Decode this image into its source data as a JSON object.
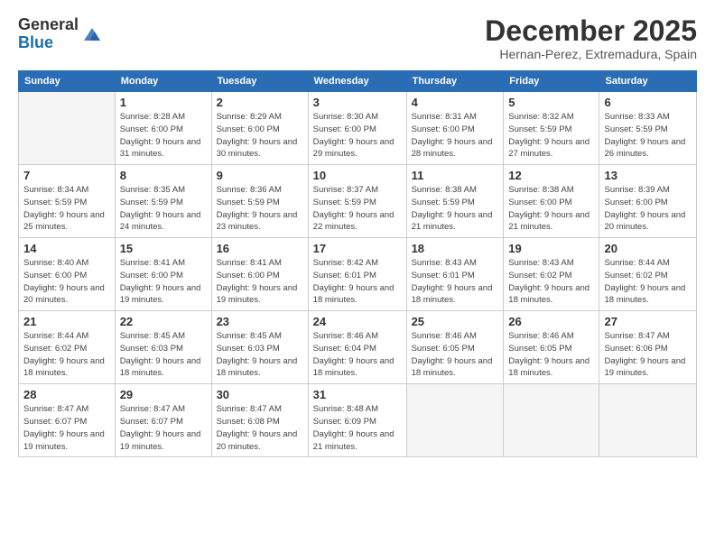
{
  "header": {
    "logo_general": "General",
    "logo_blue": "Blue",
    "month_title": "December 2025",
    "location": "Hernan-Perez, Extremadura, Spain"
  },
  "weekdays": [
    "Sunday",
    "Monday",
    "Tuesday",
    "Wednesday",
    "Thursday",
    "Friday",
    "Saturday"
  ],
  "weeks": [
    [
      {
        "day": "",
        "empty": true
      },
      {
        "day": "1",
        "sunrise": "8:28 AM",
        "sunset": "6:00 PM",
        "daylight": "9 hours and 31 minutes."
      },
      {
        "day": "2",
        "sunrise": "8:29 AM",
        "sunset": "6:00 PM",
        "daylight": "9 hours and 30 minutes."
      },
      {
        "day": "3",
        "sunrise": "8:30 AM",
        "sunset": "6:00 PM",
        "daylight": "9 hours and 29 minutes."
      },
      {
        "day": "4",
        "sunrise": "8:31 AM",
        "sunset": "6:00 PM",
        "daylight": "9 hours and 28 minutes."
      },
      {
        "day": "5",
        "sunrise": "8:32 AM",
        "sunset": "5:59 PM",
        "daylight": "9 hours and 27 minutes."
      },
      {
        "day": "6",
        "sunrise": "8:33 AM",
        "sunset": "5:59 PM",
        "daylight": "9 hours and 26 minutes."
      }
    ],
    [
      {
        "day": "7",
        "sunrise": "8:34 AM",
        "sunset": "5:59 PM",
        "daylight": "9 hours and 25 minutes."
      },
      {
        "day": "8",
        "sunrise": "8:35 AM",
        "sunset": "5:59 PM",
        "daylight": "9 hours and 24 minutes."
      },
      {
        "day": "9",
        "sunrise": "8:36 AM",
        "sunset": "5:59 PM",
        "daylight": "9 hours and 23 minutes."
      },
      {
        "day": "10",
        "sunrise": "8:37 AM",
        "sunset": "5:59 PM",
        "daylight": "9 hours and 22 minutes."
      },
      {
        "day": "11",
        "sunrise": "8:38 AM",
        "sunset": "5:59 PM",
        "daylight": "9 hours and 21 minutes."
      },
      {
        "day": "12",
        "sunrise": "8:38 AM",
        "sunset": "6:00 PM",
        "daylight": "9 hours and 21 minutes."
      },
      {
        "day": "13",
        "sunrise": "8:39 AM",
        "sunset": "6:00 PM",
        "daylight": "9 hours and 20 minutes."
      }
    ],
    [
      {
        "day": "14",
        "sunrise": "8:40 AM",
        "sunset": "6:00 PM",
        "daylight": "9 hours and 20 minutes."
      },
      {
        "day": "15",
        "sunrise": "8:41 AM",
        "sunset": "6:00 PM",
        "daylight": "9 hours and 19 minutes."
      },
      {
        "day": "16",
        "sunrise": "8:41 AM",
        "sunset": "6:00 PM",
        "daylight": "9 hours and 19 minutes."
      },
      {
        "day": "17",
        "sunrise": "8:42 AM",
        "sunset": "6:01 PM",
        "daylight": "9 hours and 18 minutes."
      },
      {
        "day": "18",
        "sunrise": "8:43 AM",
        "sunset": "6:01 PM",
        "daylight": "9 hours and 18 minutes."
      },
      {
        "day": "19",
        "sunrise": "8:43 AM",
        "sunset": "6:02 PM",
        "daylight": "9 hours and 18 minutes."
      },
      {
        "day": "20",
        "sunrise": "8:44 AM",
        "sunset": "6:02 PM",
        "daylight": "9 hours and 18 minutes."
      }
    ],
    [
      {
        "day": "21",
        "sunrise": "8:44 AM",
        "sunset": "6:02 PM",
        "daylight": "9 hours and 18 minutes."
      },
      {
        "day": "22",
        "sunrise": "8:45 AM",
        "sunset": "6:03 PM",
        "daylight": "9 hours and 18 minutes."
      },
      {
        "day": "23",
        "sunrise": "8:45 AM",
        "sunset": "6:03 PM",
        "daylight": "9 hours and 18 minutes."
      },
      {
        "day": "24",
        "sunrise": "8:46 AM",
        "sunset": "6:04 PM",
        "daylight": "9 hours and 18 minutes."
      },
      {
        "day": "25",
        "sunrise": "8:46 AM",
        "sunset": "6:05 PM",
        "daylight": "9 hours and 18 minutes."
      },
      {
        "day": "26",
        "sunrise": "8:46 AM",
        "sunset": "6:05 PM",
        "daylight": "9 hours and 18 minutes."
      },
      {
        "day": "27",
        "sunrise": "8:47 AM",
        "sunset": "6:06 PM",
        "daylight": "9 hours and 19 minutes."
      }
    ],
    [
      {
        "day": "28",
        "sunrise": "8:47 AM",
        "sunset": "6:07 PM",
        "daylight": "9 hours and 19 minutes."
      },
      {
        "day": "29",
        "sunrise": "8:47 AM",
        "sunset": "6:07 PM",
        "daylight": "9 hours and 19 minutes."
      },
      {
        "day": "30",
        "sunrise": "8:47 AM",
        "sunset": "6:08 PM",
        "daylight": "9 hours and 20 minutes."
      },
      {
        "day": "31",
        "sunrise": "8:48 AM",
        "sunset": "6:09 PM",
        "daylight": "9 hours and 21 minutes."
      },
      {
        "day": "",
        "empty": true
      },
      {
        "day": "",
        "empty": true
      },
      {
        "day": "",
        "empty": true
      }
    ]
  ]
}
